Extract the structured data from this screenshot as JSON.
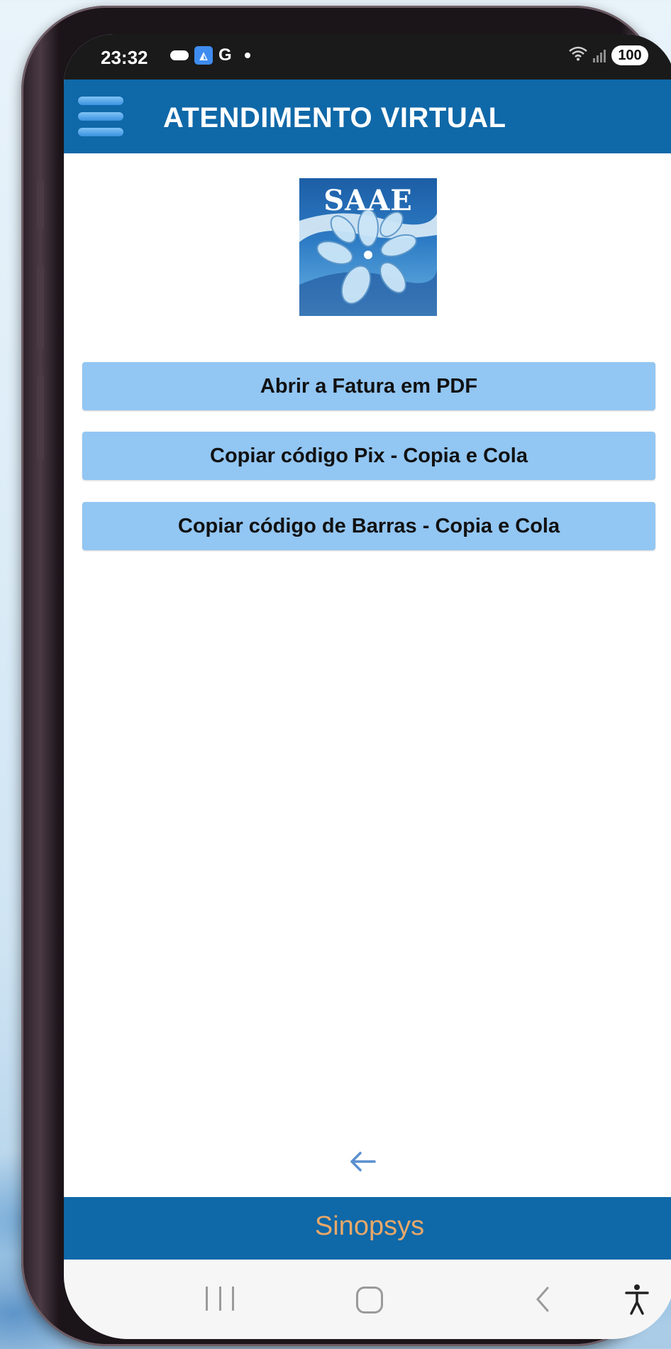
{
  "status_bar": {
    "time": "23:32",
    "notification_g": "G",
    "battery": "100"
  },
  "app_bar": {
    "title": "ATENDIMENTO VIRTUAL",
    "menu_icon": "hamburger-menu-icon"
  },
  "logo": {
    "text": "SAAE"
  },
  "actions": [
    {
      "label": "Abrir a Fatura em PDF"
    },
    {
      "label": "Copiar código Pix - Copia e Cola"
    },
    {
      "label": "Copiar código de Barras - Copia e Cola"
    }
  ],
  "back": {
    "icon": "arrow-left-icon"
  },
  "footer": {
    "text": "Sinopsys"
  },
  "colors": {
    "app_bar": "#0f68a8",
    "button": "#92c6f3",
    "footer_text": "#e8a86a",
    "back_arrow": "#5a8fd0"
  }
}
